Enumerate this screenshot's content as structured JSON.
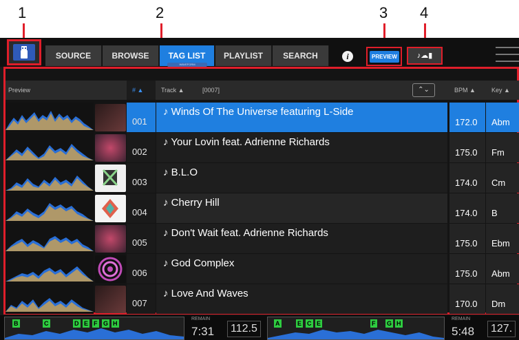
{
  "callouts": [
    "1",
    "2",
    "3",
    "4"
  ],
  "nav": {
    "tabs": [
      "SOURCE",
      "BROWSE",
      "TAG LIST",
      "PLAYLIST",
      "SEARCH"
    ],
    "active_tab": "TAG LIST",
    "tag_list_sub": "WAVEFORM",
    "info_icon": "i",
    "preview_label": "PREVIEW",
    "cloud_glyphs": "♪☁▮"
  },
  "colors": {
    "accent": "#1f7fe0",
    "callout_box": "#e01e2a",
    "hotcue": "#2ecc40"
  },
  "list": {
    "headers": {
      "preview": "Preview",
      "num": "# ▲",
      "track": "Track ▲",
      "count": "[0007]",
      "bpm": "BPM ▲",
      "key": "Key ▲"
    },
    "rows": [
      {
        "num": "001",
        "title": "Winds Of The Universe featuring L-Side",
        "bpm": "172.0",
        "key": "Abm",
        "selected": true
      },
      {
        "num": "002",
        "title": "Your Lovin feat. Adrienne Richards",
        "bpm": "175.0",
        "key": "Fm"
      },
      {
        "num": "003",
        "title": "B.L.O",
        "bpm": "174.0",
        "key": "Cm"
      },
      {
        "num": "004",
        "title": "Cherry Hill",
        "bpm": "174.0",
        "key": "B"
      },
      {
        "num": "005",
        "title": "Don't Wait feat. Adrienne Richards",
        "bpm": "175.0",
        "key": "Ebm"
      },
      {
        "num": "006",
        "title": "God Complex",
        "bpm": "175.0",
        "key": "Abm"
      },
      {
        "num": "007",
        "title": "Love And Waves",
        "bpm": "170.0",
        "key": "Dm"
      }
    ]
  },
  "decks": [
    {
      "remain_label": "REMAIN",
      "remain": "7:31",
      "bpm": "112.5",
      "cues": [
        "B",
        "C",
        "D",
        "E",
        "F",
        "G",
        "H"
      ]
    },
    {
      "remain_label": "REMAIN",
      "remain": "5:48",
      "bpm": "127.",
      "cues": [
        "A",
        "E",
        "C",
        "E",
        "F",
        "G",
        "H"
      ]
    }
  ]
}
